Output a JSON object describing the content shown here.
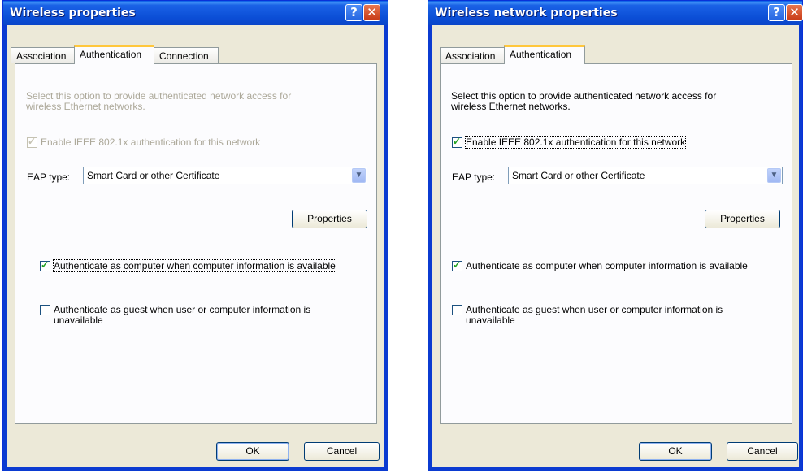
{
  "dialogs": [
    {
      "title": "Wireless properties",
      "tabs": [
        "Association",
        "Authentication",
        "Connection"
      ],
      "active_tab": "Authentication",
      "description_line1": "Select this option to provide authenticated network access for",
      "description_line2": "wireless Ethernet networks.",
      "enable_8021x_label": "Enable IEEE 802.1x authentication for this network",
      "enable_8021x_checked": true,
      "enable_8021x_disabled": true,
      "eap_type_label": "EAP type:",
      "eap_type_value": "Smart Card or other Certificate",
      "properties_label": "Properties",
      "auth_computer_label": "Authenticate as computer when computer information is available",
      "auth_computer_checked": true,
      "auth_guest_line1": "Authenticate as guest when user or computer information is",
      "auth_guest_line2": "unavailable",
      "auth_guest_checked": false,
      "ok_label": "OK",
      "cancel_label": "Cancel",
      "help_glyph": "?",
      "close_glyph": "✕"
    },
    {
      "title": "Wireless network properties",
      "tabs": [
        "Association",
        "Authentication"
      ],
      "active_tab": "Authentication",
      "description_line1": "Select this option to provide authenticated network access for",
      "description_line2": "wireless Ethernet networks.",
      "enable_8021x_label": "Enable IEEE 802.1x authentication for this network",
      "enable_8021x_checked": true,
      "enable_8021x_disabled": false,
      "eap_type_label": "EAP type:",
      "eap_type_value": "Smart Card or other Certificate",
      "properties_label": "Properties",
      "auth_computer_label": "Authenticate as computer when computer information is available",
      "auth_computer_checked": true,
      "auth_guest_line1": "Authenticate as guest when user or computer information is",
      "auth_guest_line2": "unavailable",
      "auth_guest_checked": false,
      "ok_label": "OK",
      "cancel_label": "Cancel",
      "help_glyph": "?",
      "close_glyph": "✕"
    }
  ],
  "colors": {
    "title_bar": "#0b4ed6",
    "dialog_face": "#ece9d8",
    "active_tab_accent": "#ffc73c",
    "check_mark": "#21a121",
    "close_button": "#c73a16"
  }
}
